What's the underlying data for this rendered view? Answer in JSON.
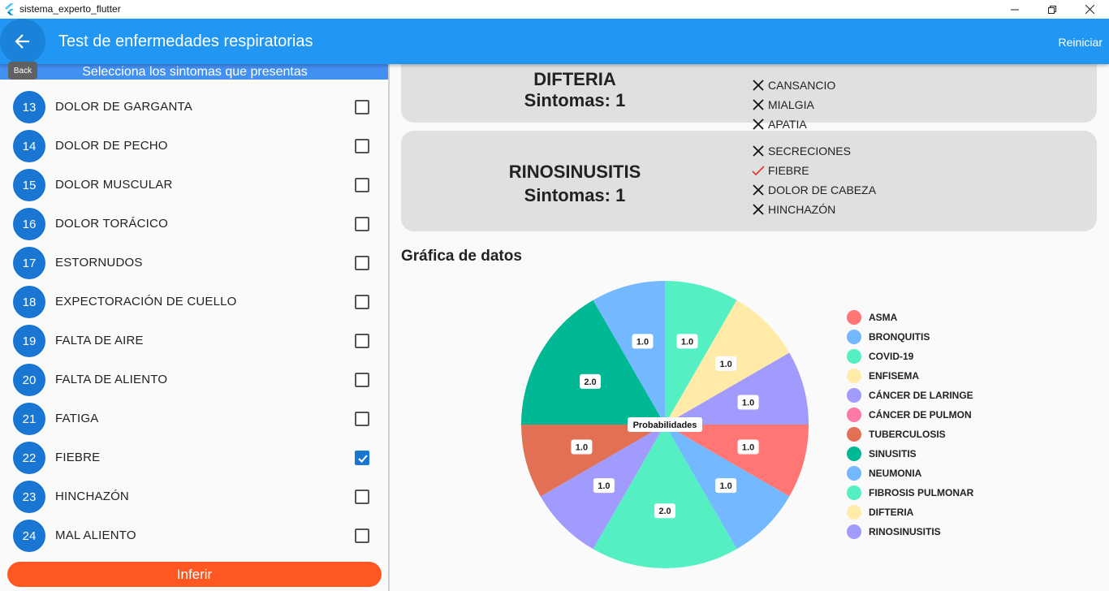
{
  "window": {
    "title": "sistema_experto_flutter"
  },
  "appbar": {
    "title": "Test de enfermedades respiratorias",
    "reset_label": "Reiniciar",
    "back_tooltip": "Back"
  },
  "left": {
    "header": "Selecciona los sintomas que presentas",
    "symptoms": [
      {
        "num": "13",
        "label": "DOLOR DE GARGANTA",
        "checked": false
      },
      {
        "num": "14",
        "label": "DOLOR DE PECHO",
        "checked": false
      },
      {
        "num": "15",
        "label": "DOLOR MUSCULAR",
        "checked": false
      },
      {
        "num": "16",
        "label": "DOLOR TORÁCICO",
        "checked": false
      },
      {
        "num": "17",
        "label": "ESTORNUDOS",
        "checked": false
      },
      {
        "num": "18",
        "label": "EXPECTORACIÓN DE CUELLO",
        "checked": false
      },
      {
        "num": "19",
        "label": "FALTA DE AIRE",
        "checked": false
      },
      {
        "num": "20",
        "label": "FALTA DE ALIENTO",
        "checked": false
      },
      {
        "num": "21",
        "label": "FATIGA",
        "checked": false
      },
      {
        "num": "22",
        "label": "FIEBRE",
        "checked": true
      },
      {
        "num": "23",
        "label": "HINCHAZÓN",
        "checked": false
      },
      {
        "num": "24",
        "label": "MAL ALIENTO",
        "checked": false
      }
    ],
    "infer_label": "Inferir"
  },
  "right": {
    "cards": [
      {
        "name": "DIFTERIA",
        "count": "Sintomas: 1",
        "symptoms": [
          {
            "label": "CANSANCIO",
            "match": false
          },
          {
            "label": "MIALGIA",
            "match": false
          },
          {
            "label": "APATIA",
            "match": false
          }
        ]
      },
      {
        "name": "RINOSINUSITIS",
        "count": "Sintomas: 1",
        "symptoms": [
          {
            "label": "SECRECIONES",
            "match": false
          },
          {
            "label": "FIEBRE",
            "match": true
          },
          {
            "label": "DOLOR DE CABEZA",
            "match": false
          },
          {
            "label": "HINCHAZÓN",
            "match": false
          }
        ]
      }
    ],
    "chart_title": "Gráfica de datos"
  },
  "chart_data": {
    "type": "pie",
    "center_label": "Probabilidades",
    "slices": [
      {
        "name": "ASMA",
        "value": 1.0,
        "color": "#ff7675"
      },
      {
        "name": "BRONQUITIS",
        "value": 1.0,
        "color": "#74b9ff"
      },
      {
        "name": "COVID-19",
        "value": 2.0,
        "color": "#55efc4"
      },
      {
        "name": "ENFISEMA",
        "value": 1.0,
        "color": "#a29bfe"
      },
      {
        "name": "CÁNCER DE LARINGE",
        "value": 1.0,
        "color": "#e17055"
      },
      {
        "name": "CÁNCER DE PULMON",
        "value": 2.0,
        "color": "#00b894"
      },
      {
        "name": "TUBERCULOSIS",
        "value": 1.0,
        "color": "#74b9ff"
      },
      {
        "name": "SINUSITIS",
        "value": 1.0,
        "color": "#55efc4"
      },
      {
        "name": "NEUMONIA",
        "value": 1.0,
        "color": "#ffeaa7"
      },
      {
        "name": "FIBROSIS PULMONAR",
        "value": 1.0,
        "color": "#a29bfe"
      }
    ],
    "legend": [
      {
        "name": "ASMA",
        "color": "#ff7675"
      },
      {
        "name": "BRONQUITIS",
        "color": "#74b9ff"
      },
      {
        "name": "COVID-19",
        "color": "#55efc4"
      },
      {
        "name": "ENFISEMA",
        "color": "#ffeaa7"
      },
      {
        "name": "CÁNCER DE LARINGE",
        "color": "#a29bfe"
      },
      {
        "name": "CÁNCER DE PULMON",
        "color": "#fd79a8"
      },
      {
        "name": "TUBERCULOSIS",
        "color": "#e17055"
      },
      {
        "name": "SINUSITIS",
        "color": "#00b894"
      },
      {
        "name": "NEUMONIA",
        "color": "#74b9ff"
      },
      {
        "name": "FIBROSIS PULMONAR",
        "color": "#55efc4"
      },
      {
        "name": "DIFTERIA",
        "color": "#ffeaa7"
      },
      {
        "name": "RINOSINUSITIS",
        "color": "#a29bfe"
      }
    ]
  }
}
